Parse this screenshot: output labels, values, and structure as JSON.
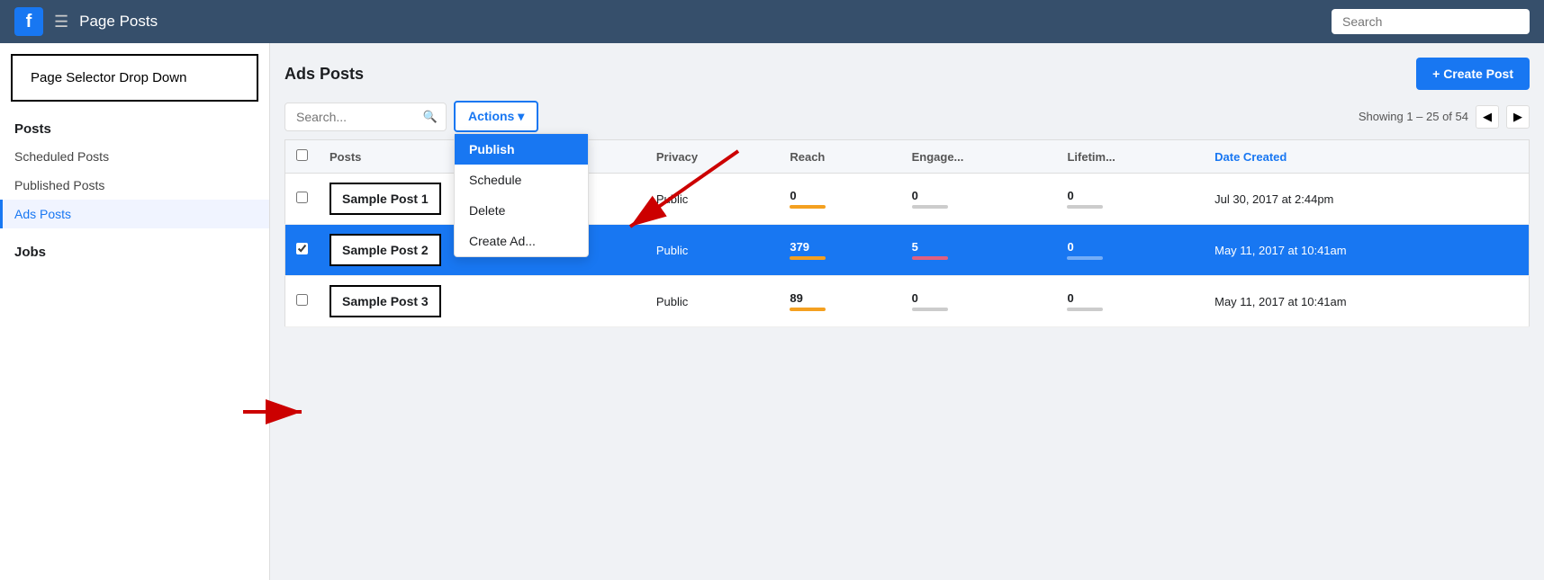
{
  "nav": {
    "title": "Page Posts",
    "logo": "f",
    "search_placeholder": "Search"
  },
  "sidebar": {
    "page_selector": "Page Selector Drop Down",
    "sections": [
      {
        "title": "Posts",
        "items": [
          {
            "label": "Scheduled Posts",
            "active": false
          },
          {
            "label": "Published Posts",
            "active": false
          },
          {
            "label": "Ads Posts",
            "active": true
          }
        ]
      },
      {
        "title": "Jobs",
        "items": []
      }
    ]
  },
  "main": {
    "title": "Ads Posts",
    "create_btn": "+ Create Post",
    "search_placeholder": "Search...",
    "actions_label": "Actions ▾",
    "pagination": "Showing 1 – 25 of 54",
    "dropdown_items": [
      {
        "label": "Publish",
        "active": true
      },
      {
        "label": "Schedule",
        "active": false
      },
      {
        "label": "Delete",
        "active": false
      },
      {
        "label": "Create Ad...",
        "active": false
      }
    ],
    "table": {
      "columns": [
        "",
        "Posts",
        "",
        "Privacy",
        "Reach",
        "Engage...",
        "Lifetim...",
        "Date Created"
      ],
      "rows": [
        {
          "checked": false,
          "post": "Sample Post 1",
          "privacy": "Public",
          "reach": "0",
          "reach_bar": "orange",
          "engage": "0",
          "engage_bar": "",
          "lifetime": "0",
          "lifetime_bar": "",
          "date": "Jul 30, 2017 at 2:44pm",
          "selected": false
        },
        {
          "checked": true,
          "post": "Sample Post 2",
          "privacy": "Public",
          "reach": "379",
          "reach_bar": "orange",
          "engage": "5",
          "engage_bar": "pink",
          "lifetime": "0",
          "lifetime_bar": "",
          "date": "May 11, 2017 at 10:41am",
          "selected": true
        },
        {
          "checked": false,
          "post": "Sample Post 3",
          "privacy": "Public",
          "reach": "89",
          "reach_bar": "orange",
          "engage": "0",
          "engage_bar": "",
          "lifetime": "0",
          "lifetime_bar": "",
          "date": "May 11, 2017 at 10:41am",
          "selected": false
        }
      ]
    }
  }
}
